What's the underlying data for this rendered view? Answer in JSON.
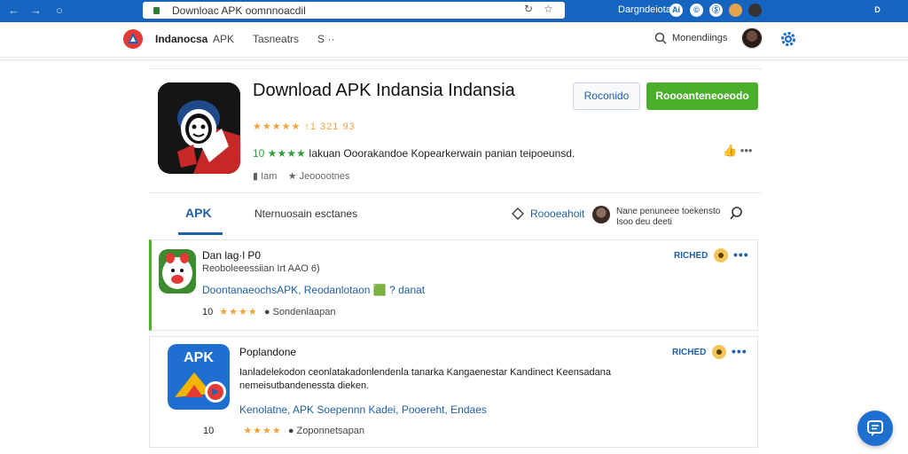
{
  "browser": {
    "url": "Downloac APK oomnnoacdil",
    "account": "Dargndeiota",
    "ext_labels": [
      "Ai",
      "©",
      "Ⓢ"
    ],
    "right_btn": "D"
  },
  "site": {
    "brand": "Indanocsa",
    "brand_suffix": "APK",
    "menu_1": "Tasneatrs",
    "menu_2": "S ··",
    "search_label": "Monendiings"
  },
  "app": {
    "title": "Download APK Indansia Indansia",
    "rating_text": "★★★★★ ↑1 321 93",
    "desc_prefix": "10 ★★★★",
    "desc_text": "Iakuan Ooorakandoe Kopearkerwain panian teipoeunsd.",
    "meta_1": "Iam",
    "meta_2": "Jeooootnes",
    "btn_secondary": "Roconido",
    "btn_primary": "Roooanteneoeodo"
  },
  "tabs": {
    "active": "APK",
    "second": "Nternuosain esctanes",
    "link": "Roooeahoit",
    "note": "Nane penuneee toekensto Isoo deu deeti"
  },
  "cards": [
    {
      "title": "Dan lag·l P0",
      "subtitle": "Reoboleeessiian Irt AAO 6)",
      "links": "DoontanaeochsAPK, Reodanlotaon 🟩 ? danat",
      "rating_num": "10",
      "stars": "★★★★",
      "rating_label": "Sondenlaapan",
      "badge": "RICHED"
    },
    {
      "title": "Poplandone",
      "subtitle": "Ianladelekodon ceonlatakadonlendenla tanarka Kangaenestar Kandinect Keensadana nemeisutbandenessta dieken.",
      "links": "Kenolatne, APK Soepennn Kadei, Pooereht, Endaes",
      "rating_num": "10",
      "stars": "★★★★",
      "rating_label": "Zoponnetsapan",
      "badge": "RICHED"
    }
  ],
  "colors": {
    "chrome": "#1565c0",
    "accent": "#1f5fa8",
    "green": "#4caf2c",
    "star": "#f0a23b"
  },
  "icons": [
    "back-arrow-icon",
    "forward-arrow-icon",
    "refresh-icon",
    "lock-icon",
    "star-bookmark-icon",
    "search-icon",
    "gear-icon",
    "thumbs-up-icon",
    "diamond-icon",
    "find-icon",
    "chat-icon"
  ]
}
